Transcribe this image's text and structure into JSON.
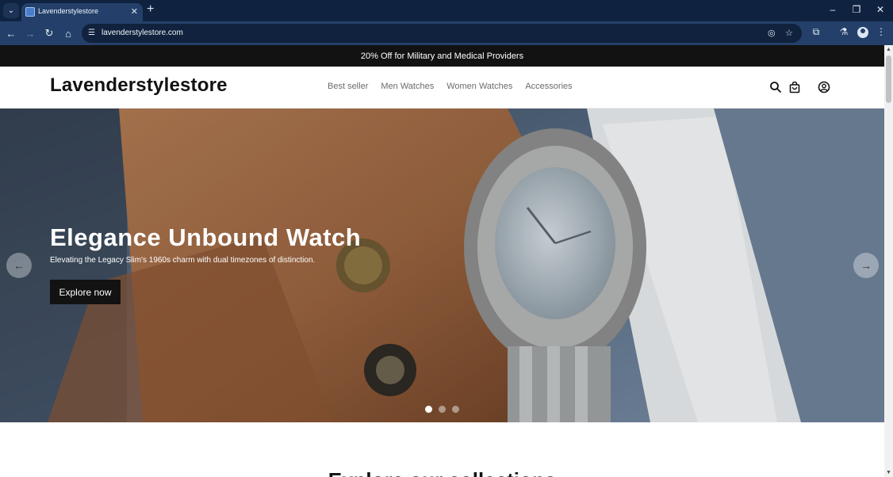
{
  "browser": {
    "tab_title": "Lavenderstylestore",
    "url": "lavenderstylestore.com"
  },
  "announcement": "20% Off for Military and Medical Providers",
  "header": {
    "logo": "Lavenderstylestore",
    "menu": [
      "Best seller",
      "Men Watches",
      "Women Watches",
      "Accessories"
    ]
  },
  "hero": {
    "title": "Elegance Unbound Watch",
    "subtitle": "Elevating the Legacy Slim's 1960s charm with dual timezones of distinction.",
    "cta": "Explore now",
    "slides_count": 3,
    "active_slide": 1
  },
  "featured": {
    "heading": "Explore our collections"
  }
}
